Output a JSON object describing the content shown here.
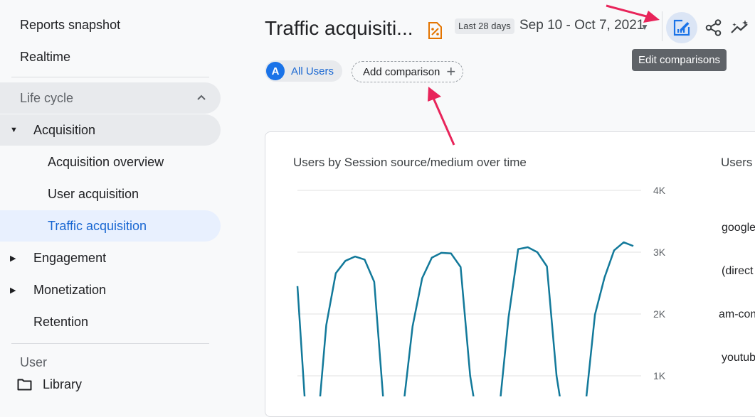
{
  "sidebar": {
    "reports_snapshot": "Reports snapshot",
    "realtime": "Realtime",
    "section_lifecycle": "Life cycle",
    "acquisition": "Acquisition",
    "acquisition_overview": "Acquisition overview",
    "user_acquisition": "User acquisition",
    "traffic_acquisition": "Traffic acquisition",
    "engagement": "Engagement",
    "monetization": "Monetization",
    "retention": "Retention",
    "section_user_partial": "User",
    "library": "Library"
  },
  "header": {
    "title": "Traffic acquisiti...",
    "range_chip": "Last 28 days",
    "date_range": "Sep 10 - Oct 7, 2021",
    "tooltip": "Edit comparisons"
  },
  "comparisons": {
    "segment_badge": "A",
    "segment_label": "All Users",
    "add_label": "Add comparison",
    "add_symbol": "+"
  },
  "card": {
    "chart_title": "Users by Session source/medium over time",
    "side_title": "Users",
    "legend": [
      "google",
      "(direct",
      "am-com",
      "youtub"
    ]
  },
  "colors": {
    "accent": "#1a73e8",
    "series_line": "#12799a",
    "annotation_arrow": "#e8245a",
    "selected_nav_bg": "#e8f0fe"
  },
  "icons": {
    "insights_badge": "orange-percent-icon",
    "edit_comparisons": "edit-comparison-icon",
    "share": "share-icon",
    "insights": "sparkline-insights-icon",
    "library": "folder-icon"
  },
  "chart_data": {
    "type": "line",
    "title": "Users by Session source/medium over time",
    "y_ticks": [
      "4K",
      "3K",
      "2K",
      "1K"
    ],
    "ylim": [
      0,
      4000
    ],
    "grid": true,
    "series": [
      {
        "values": [
          2450,
          50,
          0,
          1820,
          2660,
          2860,
          2930,
          2880,
          2520,
          500,
          0,
          450,
          1800,
          2580,
          2910,
          2990,
          2980,
          2760,
          1000,
          30,
          0,
          400,
          1950,
          3050,
          3080,
          3000,
          2770,
          1000,
          10,
          0,
          500,
          1990,
          2590,
          3030,
          3160,
          3100
        ]
      }
    ]
  }
}
